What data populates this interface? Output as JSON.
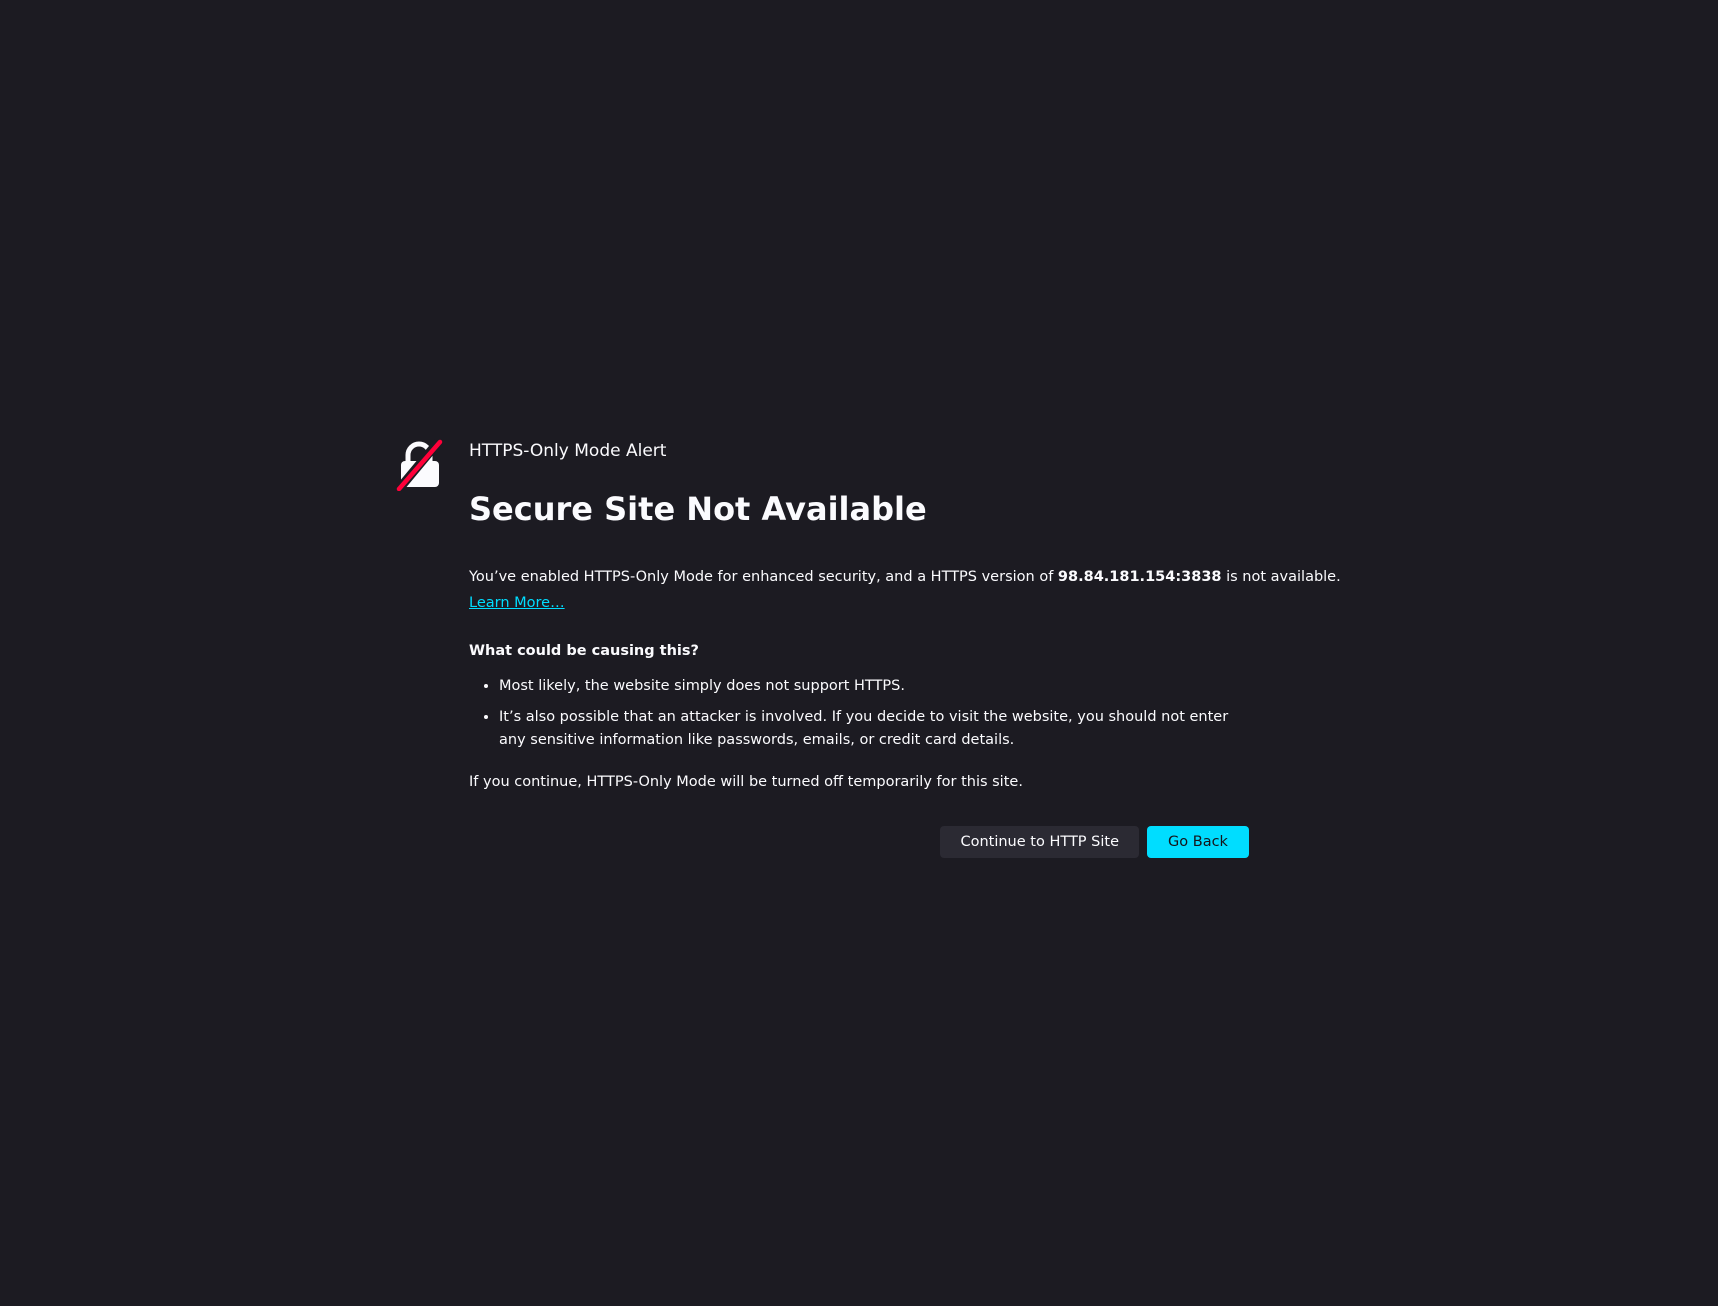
{
  "theme": {
    "background": "#1c1b22",
    "text": "#fbfbfe",
    "accent": "#00ddff",
    "secondary_button_bg": "#2b2a33",
    "lock_slash": "#ff0039"
  },
  "alert": {
    "icon": "broken-lock-icon",
    "eyebrow": "HTTPS-Only Mode Alert",
    "title": "Secure Site Not Available",
    "intro_before": "You’ve enabled HTTPS-Only Mode for enhanced security, and a HTTPS version of ",
    "host": "98.84.181.154:3838",
    "intro_after": " is not available.",
    "learn_more": "Learn More…",
    "cause_heading": "What could be causing this?",
    "causes": [
      "Most likely, the website simply does not support HTTPS.",
      "It’s also possible that an attacker is involved. If you decide to visit the website, you should not enter any sensitive information like passwords, emails, or credit card details."
    ],
    "continue_note": "If you continue, HTTPS-Only Mode will be turned off temporarily for this site."
  },
  "buttons": {
    "continue_label": "Continue to HTTP Site",
    "back_label": "Go Back"
  }
}
